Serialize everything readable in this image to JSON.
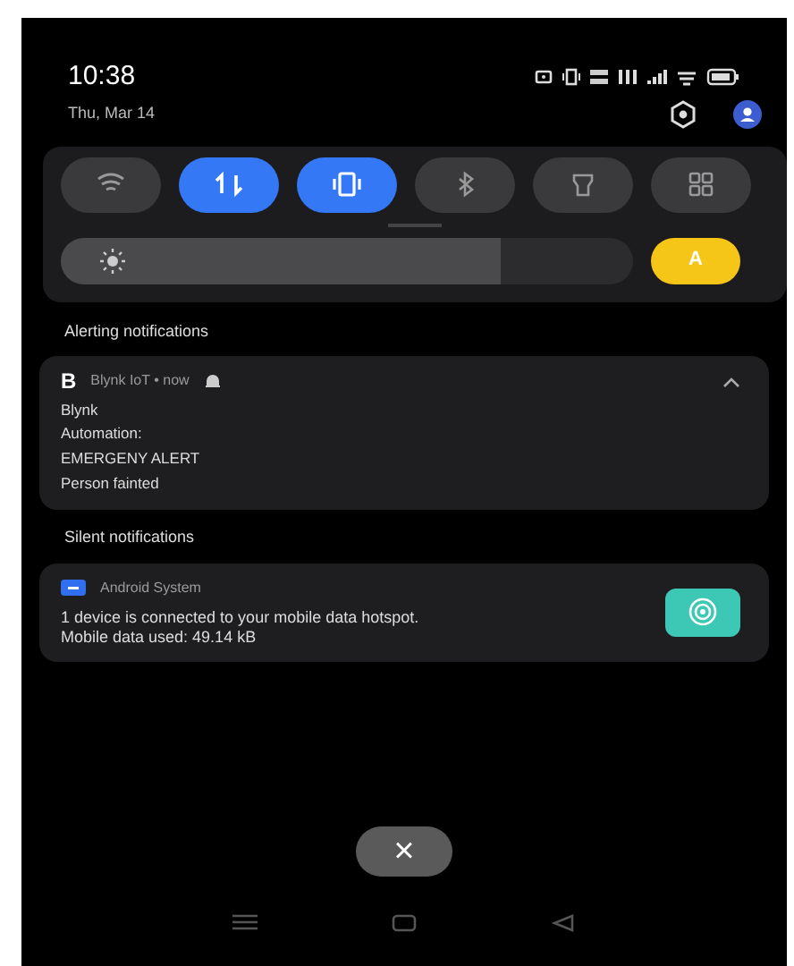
{
  "status_bar": {
    "time": "10:38",
    "date": "Thu, Mar 14"
  },
  "quick_settings": {
    "tiles": [
      {
        "kind": "wifi",
        "on": false
      },
      {
        "kind": "data",
        "on": true
      },
      {
        "kind": "vibrate",
        "on": true
      },
      {
        "kind": "bluetooth",
        "on": false
      },
      {
        "kind": "flashlight",
        "on": false
      },
      {
        "kind": "apps",
        "on": false
      }
    ],
    "brightness": {
      "level": 0.77
    },
    "auto_brightness": {
      "label": "A",
      "on": true
    }
  },
  "sections": [
    {
      "title": "Alerting notifications",
      "notifications": [
        {
          "app_icon": "B",
          "app": "Blynk IoT • now",
          "expanded": true,
          "lines": [
            "Blynk",
            "Automation:",
            "EMERGENY ALERT",
            "Person fainted"
          ]
        }
      ]
    },
    {
      "title": "Silent notifications",
      "notifications": [
        {
          "app": "Android System",
          "expanded": false,
          "lines": [
            "1 device is connected to your mobile data hotspot.",
            "Mobile data used: 49.14 kB"
          ]
        }
      ]
    }
  ],
  "clear_button": "×"
}
